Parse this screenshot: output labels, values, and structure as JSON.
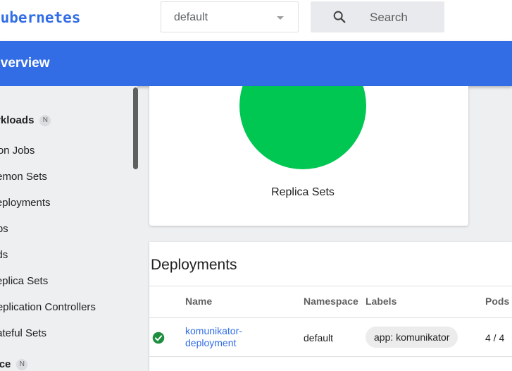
{
  "header": {
    "brand": "kubernetes",
    "namespace_selected": "default",
    "search_label": "Search"
  },
  "titlebar": {
    "title": "Overview"
  },
  "sidebar": {
    "workloads": {
      "label": "Workloads",
      "badge": "N"
    },
    "items": [
      {
        "label": "Cron Jobs"
      },
      {
        "label": "Daemon Sets"
      },
      {
        "label": "Deployments"
      },
      {
        "label": "Jobs"
      },
      {
        "label": "Pods"
      },
      {
        "label": "Replica Sets"
      },
      {
        "label": "Replication Controllers"
      },
      {
        "label": "Stateful Sets"
      }
    ],
    "service": {
      "label": "Service",
      "badge": "N"
    }
  },
  "replica_sets_card": {
    "label": "Replica Sets",
    "status_color": "#00c752"
  },
  "deployments": {
    "heading": "Deployments",
    "columns": {
      "name": "Name",
      "namespace": "Namespace",
      "labels": "Labels",
      "pods": "Pods"
    },
    "rows": [
      {
        "status": "running",
        "name_line1": "komunikator-",
        "name_line2": "deployment",
        "namespace": "default",
        "label": "app: komunikator",
        "pods": "4 / 4"
      }
    ]
  },
  "colors": {
    "accent": "#326de6",
    "success": "#00c752"
  }
}
